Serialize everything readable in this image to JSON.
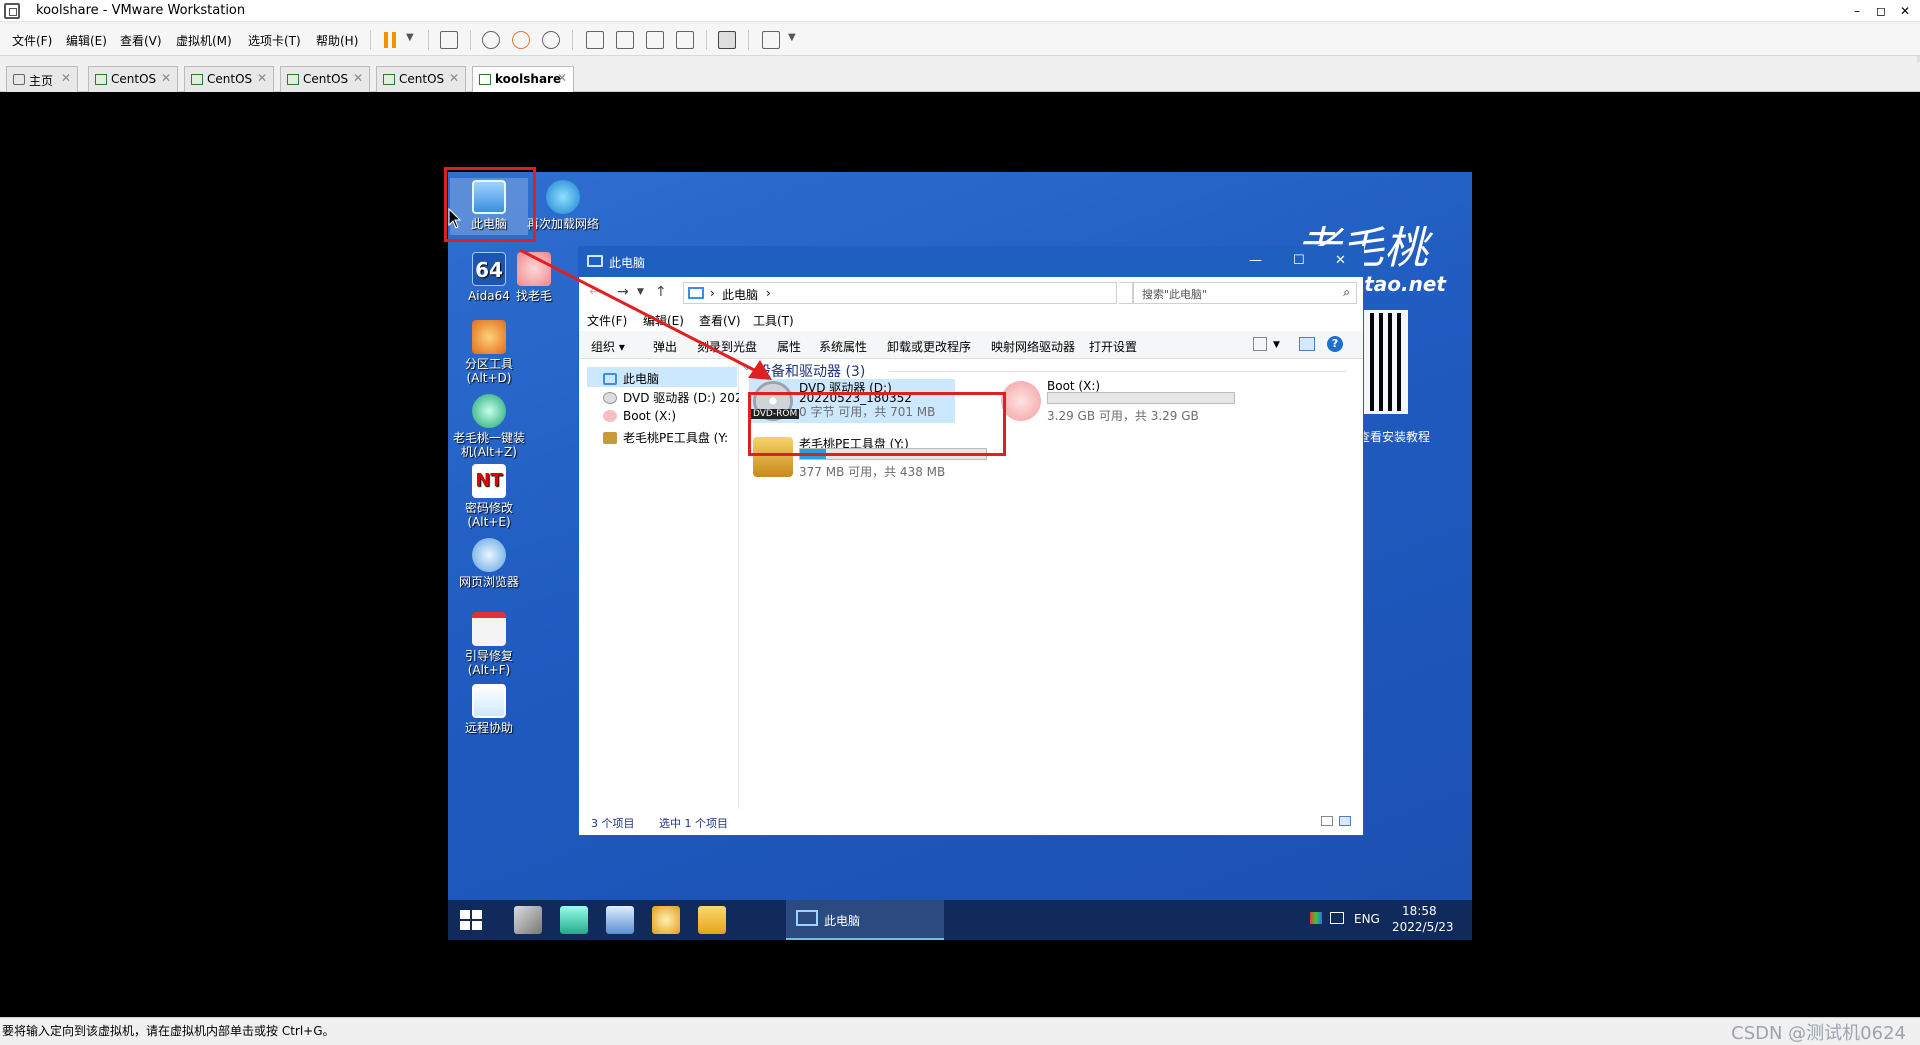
{
  "window": {
    "title": "koolshare - VMware Workstation",
    "controls": [
      "–",
      "◻",
      "✕"
    ]
  },
  "menu": [
    "文件(F)",
    "编辑(E)",
    "查看(V)",
    "虚拟机(M)",
    "选项卡(T)",
    "帮助(H)"
  ],
  "tabs": [
    {
      "label": "主页",
      "active": false
    },
    {
      "label": "CentOS",
      "active": false
    },
    {
      "label": "CentOS",
      "active": false
    },
    {
      "label": "CentOS",
      "active": false
    },
    {
      "label": "CentOS",
      "active": false
    },
    {
      "label": "koolshare",
      "active": true
    }
  ],
  "desktop": {
    "icons": [
      {
        "label": "此电脑",
        "icon": "computer-icon"
      },
      {
        "label": "再次加载网络",
        "icon": "network-icon"
      },
      {
        "label": "Aida64",
        "icon": "aida64-icon"
      },
      {
        "label": "找老毛",
        "icon": "peach-icon"
      },
      {
        "label": "分区工具\n(Alt+D)",
        "icon": "partition-tool-icon"
      },
      {
        "label": "老毛桃一键装\n机(Alt+Z)",
        "icon": "one-click-install-icon"
      },
      {
        "label": "密码修改\n(Alt+E)",
        "icon": "password-reset-icon"
      },
      {
        "label": "网页浏览器",
        "icon": "web-browser-icon"
      },
      {
        "label": "引导修复\n(Alt+F)",
        "icon": "boot-repair-icon"
      },
      {
        "label": "远程协助",
        "icon": "remote-assist-icon"
      }
    ],
    "brand": "老毛桃",
    "brand_url": "tao.net",
    "qr_caption": "查看安装教程"
  },
  "explorer": {
    "title": "此电脑",
    "address": "此电脑",
    "search_placeholder": "搜索\"此电脑\"",
    "menu": [
      "文件(F)",
      "编辑(E)",
      "查看(V)",
      "工具(T)"
    ],
    "commands": [
      "组织 ▾",
      "弹出",
      "刻录到光盘",
      "属性",
      "系统属性",
      "卸载或更改程序",
      "映射网络驱动器",
      "打开设置"
    ],
    "tree": [
      "此电脑",
      "DVD 驱动器 (D:) 2022",
      "Boot (X:)",
      "老毛桃PE工具盘 (Y:"
    ],
    "group_header": "设备和驱动器 (3)",
    "drives": [
      {
        "name": "DVD 驱动器 (D:)",
        "label": "20220523_180352",
        "free": "0 字节 可用，共 701 MB",
        "badge": "DVD-ROM",
        "used_pct": 100
      },
      {
        "name": "Boot (X:)",
        "free": "3.29 GB 可用，共 3.29 GB",
        "used_pct": 0
      },
      {
        "name": "老毛桃PE工具盘 (Y:)",
        "free": "377 MB 可用，共 438 MB",
        "used_pct": 14
      }
    ],
    "status_count": "3 个项目",
    "status_selected": "选中 1 个项目"
  },
  "taskbar": {
    "active_label": "此电脑",
    "lang": "ENG",
    "time": "18:58",
    "date": "2022/5/23"
  },
  "statusbar": {
    "message": "要将输入定向到该虚拟机，请在虚拟机内部单击或按 Ctrl+G。",
    "watermark": "CSDN @测试机0624"
  },
  "colors": {
    "accent": "#1f5fbf",
    "annotation": "#e02020",
    "selection": "#cce8ff"
  }
}
